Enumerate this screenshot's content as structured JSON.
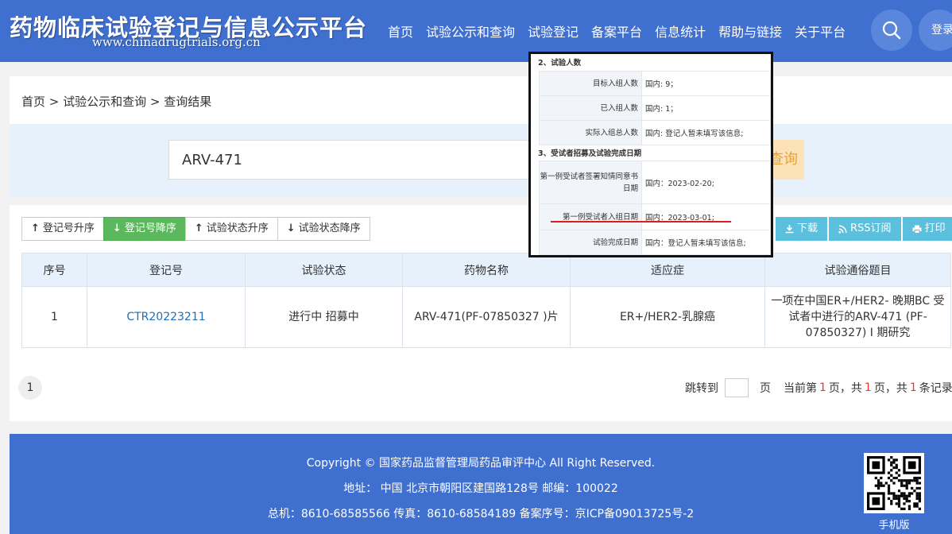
{
  "header": {
    "title": "药物临床试验登记与信息公示平台",
    "url": "www.chinadrugtrials.org.cn",
    "nav": [
      "首页",
      "试验公示和查询",
      "试验登记",
      "备案平台",
      "信息统计",
      "帮助与链接",
      "关于平台"
    ],
    "login": "登录"
  },
  "breadcrumb": "首页 > 试验公示和查询 > 查询结果",
  "search": {
    "value": "ARV-471",
    "button": "查询"
  },
  "sort_buttons": [
    {
      "label": "登记号升序",
      "arrow": "↑",
      "active": false
    },
    {
      "label": "登记号降序",
      "arrow": "↓",
      "active": true
    },
    {
      "label": "试验状态升序",
      "arrow": "↑",
      "active": false
    },
    {
      "label": "试验状态降序",
      "arrow": "↓",
      "active": false
    }
  ],
  "actions": [
    {
      "label": "下载",
      "icon": "download-icon"
    },
    {
      "label": "RSS订阅",
      "icon": "rss-icon"
    },
    {
      "label": "打印",
      "icon": "print-icon"
    }
  ],
  "table": {
    "headers": [
      "序号",
      "登记号",
      "试验状态",
      "药物名称",
      "适应症",
      "试验通俗题目"
    ],
    "rows": [
      [
        "1",
        "CTR20223211",
        "进行中 招募中",
        "ARV-471(PF-07850327 )片",
        "ER+/HER2-乳腺癌",
        "一项在中国ER+/HER2- 晚期BC 受试者中进行的ARV-471 (PF-07850327) I 期研究"
      ]
    ]
  },
  "pager": {
    "current_page": "1",
    "jump_label": "跳转到",
    "page_unit": "页",
    "current_prefix": "当前第",
    "current_value": "1",
    "current_suffix": "页，共",
    "total_pages": "1",
    "total_pages_suffix": "页，共",
    "total_records": "1",
    "total_records_suffix": "条记录"
  },
  "footer": {
    "copyright": "Copyright © 国家药品监督管理局药品审评中心 All Right Reserved.",
    "address": "地址： 中国 北京市朝阳区建国路128号 邮编：100022",
    "contact": "总机：8610-68585566 传真：8610-68584189 备案序号：京ICP备09013725号-2",
    "mobile_label": "手机版"
  },
  "overlay": {
    "section1": "2、试验人数",
    "rows1": [
      {
        "key": "目标入组人数",
        "value": "国内: 9；"
      },
      {
        "key": "已入组人数",
        "value": "国内: 1；"
      },
      {
        "key": "实际入组总人数",
        "value": "国内: 登记人暂未填写该信息;"
      }
    ],
    "section2": "3、受试者招募及试验完成日期",
    "rows2": [
      {
        "key": "第一例受试者签署知情同意书日期",
        "value": "国内：2023-02-20;"
      },
      {
        "key": "第一例受试者入组日期",
        "value": "国内：2023-03-01;"
      },
      {
        "key": "试验完成日期",
        "value": "国内：登记人暂未填写该信息;"
      }
    ]
  },
  "colors": {
    "header_bg": "#3f6fcf",
    "sort_active": "#5cb85c",
    "action_btn": "#5bc0de",
    "link": "#1f6fb5",
    "highlight": "#d81e1e"
  }
}
